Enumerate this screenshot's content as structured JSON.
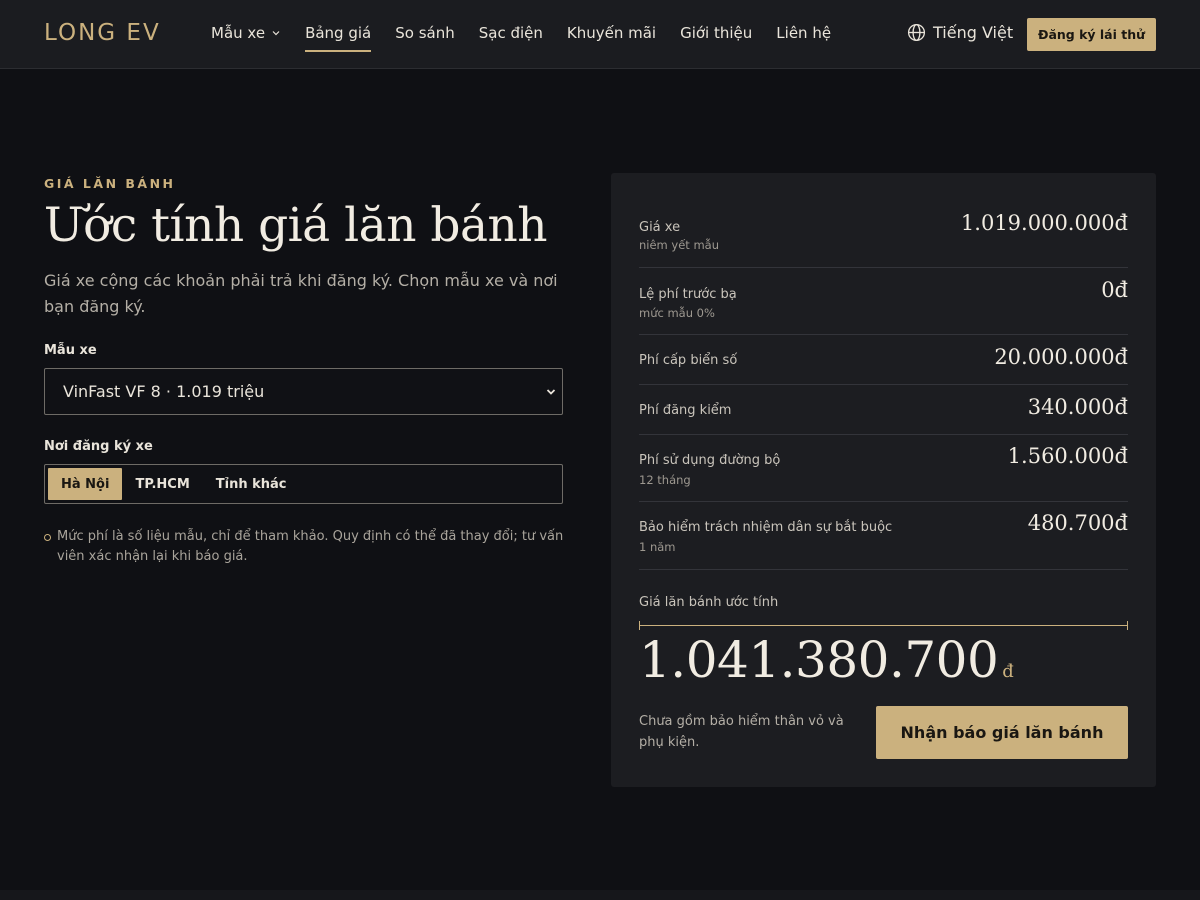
{
  "header": {
    "logo": "LONG EV",
    "nav": [
      {
        "label": "Mẫu xe",
        "dropdown": true
      },
      {
        "label": "Bảng giá",
        "active": true
      },
      {
        "label": "So sánh"
      },
      {
        "label": "Sạc điện"
      },
      {
        "label": "Khuyến mãi"
      },
      {
        "label": "Giới thiệu"
      },
      {
        "label": "Liên hệ"
      }
    ],
    "language": "Tiếng Việt",
    "cta": "Đăng ký lái thử"
  },
  "hero": {
    "eyebrow": "GIÁ LĂN BÁNH",
    "title": "Ước tính giá lăn bánh",
    "subtitle": "Giá xe cộng các khoản phải trả khi đăng ký. Chọn mẫu xe và nơi bạn đăng ký."
  },
  "form": {
    "model_label": "Mẫu xe",
    "model_value": "VinFast VF 8 · 1.019 triệu",
    "region_label": "Nơi đăng ký xe",
    "regions": [
      "Hà Nội",
      "TP.HCM",
      "Tỉnh khác"
    ],
    "region_selected": "Hà Nội",
    "note": "Mức phí là số liệu mẫu, chỉ để tham khảo. Quy định có thể đã thay đổi; tư vấn viên xác nhận lại khi báo giá."
  },
  "breakdown": {
    "rows": [
      {
        "label": "Giá xe",
        "sub": "niêm yết mẫu",
        "value": "1.019.000.000đ"
      },
      {
        "label": "Lệ phí trước bạ",
        "sub": "mức mẫu 0%",
        "value": "0đ"
      },
      {
        "label": "Phí cấp biển số",
        "sub": "",
        "value": "20.000.000đ"
      },
      {
        "label": "Phí đăng kiểm",
        "sub": "",
        "value": "340.000đ"
      },
      {
        "label": "Phí sử dụng đường bộ",
        "sub": "12 tháng",
        "value": "1.560.000đ"
      },
      {
        "label": "Bảo hiểm trách nhiệm dân sự bắt buộc",
        "sub": "1 năm",
        "value": "480.700đ"
      }
    ],
    "total_label": "Giá lăn bánh ước tính",
    "total_value": "1.041.380.700",
    "total_unit": "đ",
    "foot_note": "Chưa gồm bảo hiểm thân vỏ và phụ kiện.",
    "cta": "Nhận báo giá lăn bánh"
  },
  "colors": {
    "accent": "#cbb17e",
    "background": "#0f1014",
    "card": "#1c1d21"
  }
}
